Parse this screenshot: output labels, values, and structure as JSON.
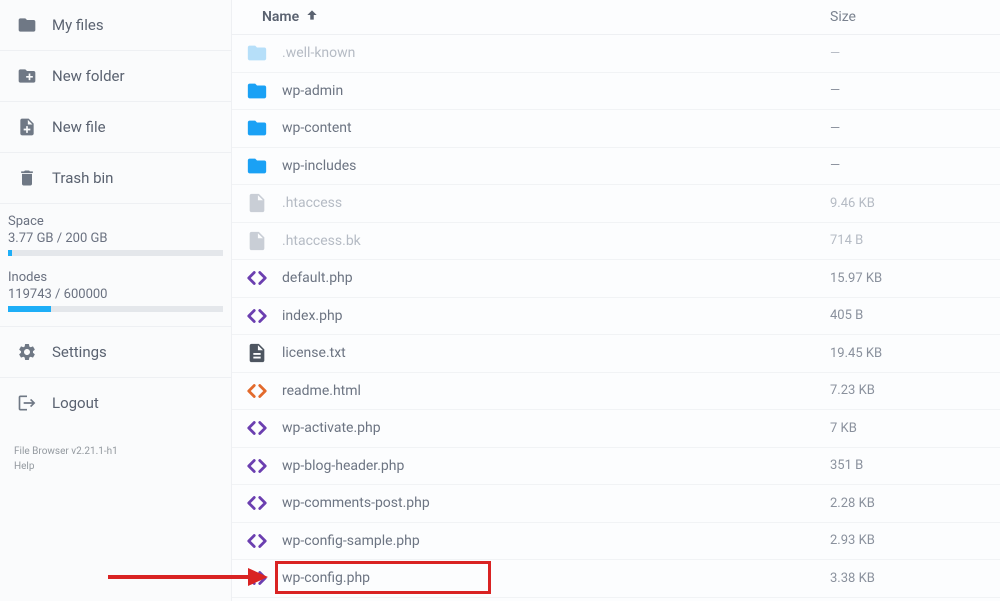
{
  "sidebar": {
    "my_files": "My files",
    "new_folder": "New folder",
    "new_file": "New file",
    "trash_bin": "Trash bin",
    "settings": "Settings",
    "logout": "Logout",
    "space_label": "Space",
    "space_value": "3.77 GB / 200 GB",
    "space_pct": 2,
    "inodes_label": "Inodes",
    "inodes_value": "119743 / 600000",
    "inodes_pct": 20,
    "version": "File Browser v2.21.1-h1",
    "help": "Help"
  },
  "header": {
    "name_label": "Name",
    "size_label": "Size"
  },
  "files": [
    {
      "name": ".well-known",
      "size": "—",
      "icon": "folder",
      "dim": true
    },
    {
      "name": "wp-admin",
      "size": "—",
      "icon": "folder",
      "dim": false
    },
    {
      "name": "wp-content",
      "size": "—",
      "icon": "folder",
      "dim": false
    },
    {
      "name": "wp-includes",
      "size": "—",
      "icon": "folder",
      "dim": false
    },
    {
      "name": ".htaccess",
      "size": "9.46 KB",
      "icon": "file",
      "dim": true
    },
    {
      "name": ".htaccess.bk",
      "size": "714 B",
      "icon": "file",
      "dim": true
    },
    {
      "name": "default.php",
      "size": "15.97 KB",
      "icon": "code",
      "dim": false
    },
    {
      "name": "index.php",
      "size": "405 B",
      "icon": "code",
      "dim": false
    },
    {
      "name": "license.txt",
      "size": "19.45 KB",
      "icon": "text",
      "dim": false
    },
    {
      "name": "readme.html",
      "size": "7.23 KB",
      "icon": "codeor",
      "dim": false
    },
    {
      "name": "wp-activate.php",
      "size": "7 KB",
      "icon": "code",
      "dim": false
    },
    {
      "name": "wp-blog-header.php",
      "size": "351 B",
      "icon": "code",
      "dim": false
    },
    {
      "name": "wp-comments-post.php",
      "size": "2.28 KB",
      "icon": "code",
      "dim": false
    },
    {
      "name": "wp-config-sample.php",
      "size": "2.93 KB",
      "icon": "code",
      "dim": false
    },
    {
      "name": "wp-config.php",
      "size": "3.38 KB",
      "icon": "code",
      "dim": false
    }
  ],
  "colors": {
    "folder_blue": "#1aa1f5",
    "folder_light": "#b6dff9",
    "file_gray": "#c9ced6",
    "code_purple": "#6b3fb0",
    "code_orange": "#e26a2c",
    "text_dark": "#4d5560"
  }
}
